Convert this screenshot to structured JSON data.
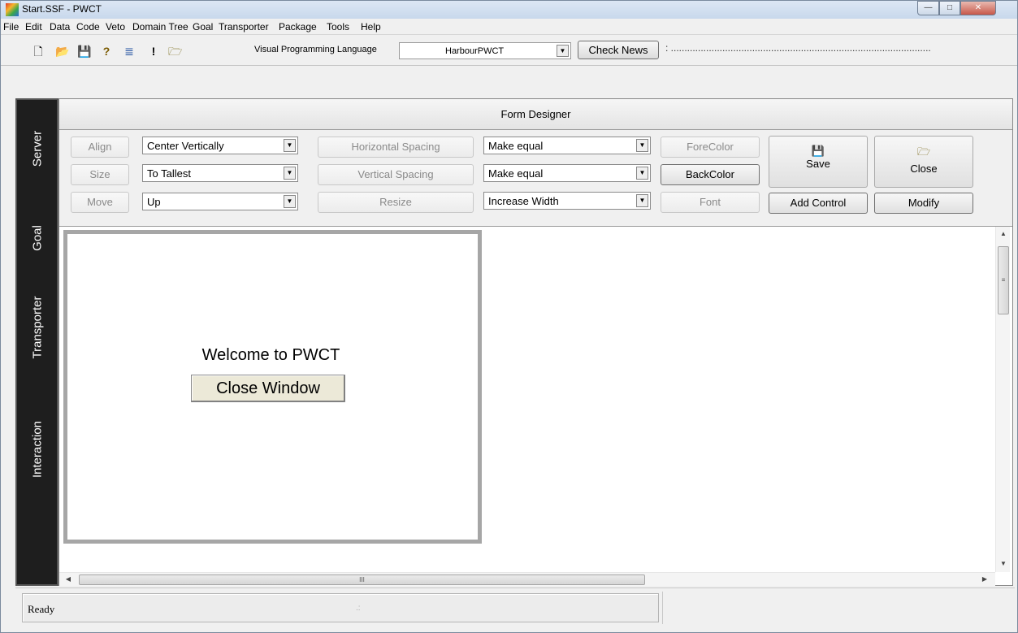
{
  "window": {
    "title": "Start.SSF  - PWCT",
    "min_glyph": "—",
    "max_glyph": "□",
    "close_glyph": "✕"
  },
  "menu": [
    "File",
    "Edit",
    "Data",
    "Code",
    "Veto",
    "Domain Tree",
    "Goal",
    "Transporter",
    "Package",
    "Tools",
    "Help"
  ],
  "toolbar": {
    "icons": [
      {
        "name": "new-file-icon",
        "glyph": "🗋"
      },
      {
        "name": "open-folder-icon",
        "glyph": "📂"
      },
      {
        "name": "save-disk-icon",
        "glyph": "💾"
      },
      {
        "name": "help-question-icon",
        "glyph": "?"
      },
      {
        "name": "document-icon",
        "glyph": "≣"
      },
      {
        "name": "exclamation-icon",
        "glyph": "!"
      },
      {
        "name": "folder-up-icon",
        "glyph": "🗁"
      }
    ],
    "vpl_label": "Visual Programming Language",
    "vpl_value": "HarbourPWCT",
    "check_news": "Check News",
    "news_text": ":  ................................................................................................"
  },
  "sidebar": {
    "tabs": [
      "Server",
      "Goal",
      "Transporter",
      "Interaction"
    ]
  },
  "form_designer": {
    "header": "Form Designer",
    "align_btn": "Align",
    "size_btn": "Size",
    "move_btn": "Move",
    "align_value": "Center Vertically",
    "size_value": "To Tallest",
    "move_value": "Up",
    "hspacing_btn": "Horizontal Spacing",
    "vspacing_btn": "Vertical Spacing",
    "resize_btn": "Resize",
    "hspacing_value": "Make equal",
    "vspacing_value": "Make equal",
    "resize_value": "Increase Width",
    "forecolor_btn": "ForeColor",
    "backcolor_btn": "BackColor",
    "font_btn": "Font",
    "save_btn": "Save",
    "close_btn": "Close",
    "add_control_btn": "Add Control",
    "modify_btn": "Modify"
  },
  "preview_form": {
    "welcome_text": "Welcome to PWCT",
    "close_window_btn": "Close Window"
  },
  "statusbar": {
    "text": "Ready"
  }
}
